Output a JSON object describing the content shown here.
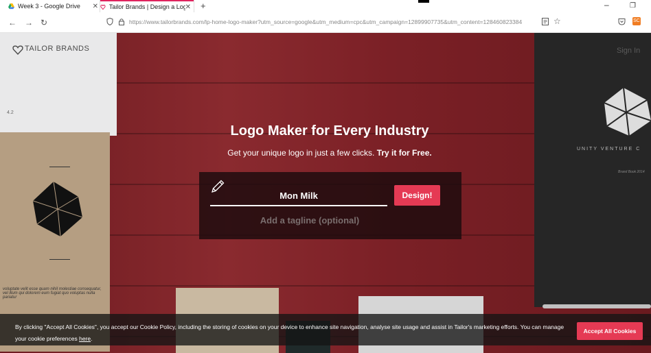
{
  "browser": {
    "tabs": [
      {
        "title": "Week 3 - Google Drive"
      },
      {
        "title": "Tailor Brands | Design a Logo &"
      }
    ],
    "url_domain": "https://www.tailorbrands.com",
    "url_path": "/lp-home-logo-maker?utm_source=google&utm_medium=cpc&utm_campaign=12899907735&utm_content=128460823384",
    "extension_badge": "SC"
  },
  "page": {
    "brand": "TAILOR BRANDS",
    "sign_in": "Sign In",
    "hero": {
      "title": "Logo Maker for Every Industry",
      "subtitle": "Get your unique logo in just a few clicks.",
      "subtitle_cta": "Try it for Free."
    },
    "form": {
      "business_name": "Mon Milk",
      "tagline_placeholder": "Add a tagline (optional)",
      "design_label": "Design!"
    },
    "decor": {
      "page_number": "4.2",
      "unity_text": "UNITY VENTURE C",
      "unity_small": "Brand Book 2014",
      "latin_note": "voluptate velit esse quam nihil molestiae consequatur, vel illum qui dolorem eum fugiat quo voluptas nulla pariatur"
    }
  },
  "cookie_bar": {
    "text": "By clicking \"Accept All Cookies\", you accept our Cookie Policy, including the storing of cookies on your device to enhance site navigation, analyse site usage and assist in Tailor's marketing efforts. You can manage your cookie preferences",
    "link": "here",
    "tail": ".",
    "accept_label": "Accept All Cookies"
  },
  "colors": {
    "accent": "#e53a54",
    "background_wood": "#7a1f24"
  }
}
